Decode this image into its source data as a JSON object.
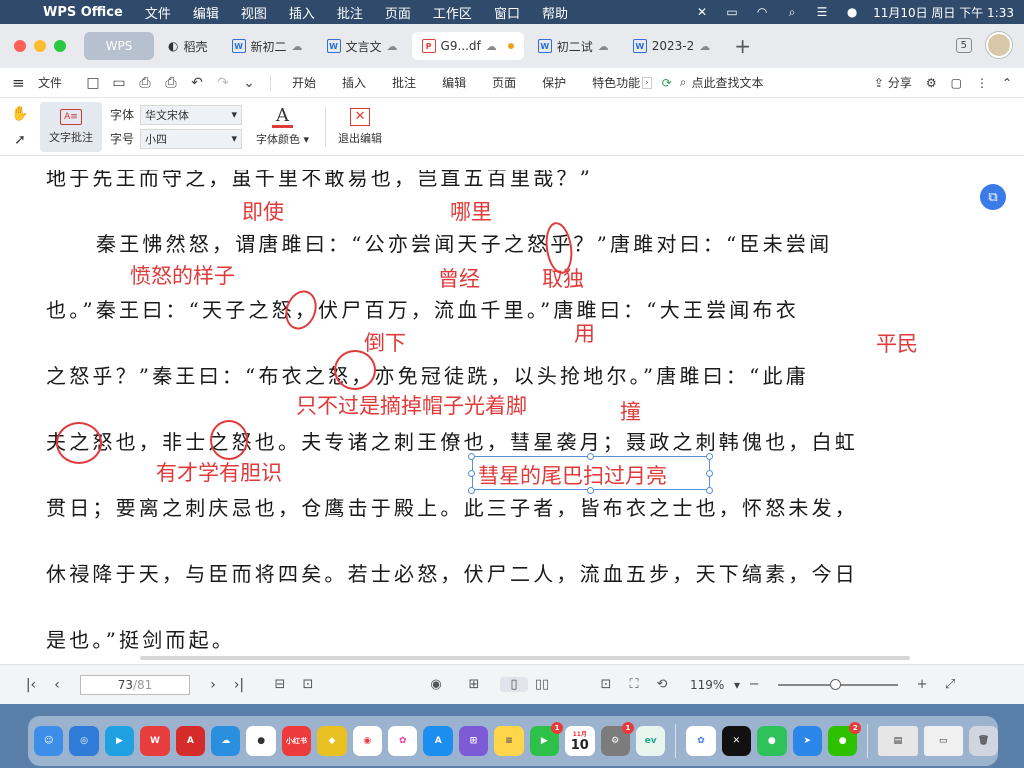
{
  "menubar": {
    "app_name": "WPS Office",
    "items": [
      "文件",
      "编辑",
      "视图",
      "插入",
      "批注",
      "页面",
      "工作区",
      "窗口",
      "帮助"
    ],
    "datetime": "11月10日 周日 下午 1:33"
  },
  "tabs": [
    {
      "label": "WPS"
    },
    {
      "label": "稻壳"
    },
    {
      "label": "新初二"
    },
    {
      "label": "文言文"
    },
    {
      "label": "G9...df"
    },
    {
      "label": "初二试"
    },
    {
      "label": "2023-2"
    }
  ],
  "toolbar": {
    "file_label": "文件",
    "ribbon_tabs": [
      "开始",
      "插入",
      "批注",
      "编辑",
      "页面",
      "保护",
      "特色功能"
    ],
    "search_label": "点此查找文本",
    "share_label": "分享",
    "page_count_badge": "5"
  },
  "ribbon": {
    "annotate_label": "文字批注",
    "font_label": "字体",
    "font_value": "华文宋体",
    "size_label": "字号",
    "size_value": "小四",
    "font_color_label": "字体颜色",
    "exit_label": "退出编辑"
  },
  "document": {
    "lines": [
      "地于先王而守之，虽千里不敢易也，岂直五百里哉？”",
      "秦王怫然怒，谓唐雎曰：“公亦尝闻天子之怒乎？”唐雎对曰：“臣未尝闻",
      "也。”秦王曰：“天子之怒，伏尸百万，流血千里。”唐雎曰：“大王尝闻布衣",
      "之怒乎？”秦王曰：“布衣之怒，亦免冠徒跣，以头抢地尔。”唐雎曰：“此庸",
      "夫之怒也，非士之怒也。夫专诸之刺王僚也，彗星袭月；聂政之刺韩傀也，白虹",
      "贯日；要离之刺庆忌也，仓鹰击于殿上。此三子者，皆布衣之士也，怀怒未发，",
      "休祲降于天，与臣而将四矣。若士必怒，伏尸二人，流血五步，天下缟素，今日",
      "是也。”挺剑而起。"
    ],
    "annotations": {
      "jishi": "即使",
      "nali": "哪里",
      "fennu": "愤怒的样子",
      "cengjing": "曾经",
      "qudu": "取独",
      "daoxia": "倒下",
      "yong": "用",
      "pingmin": "平民",
      "zhaimao": "只不过是摘掉帽子光着脚",
      "zhuang": "撞",
      "youcai": "有才学有胆识",
      "huixing": "彗星的尾巴扫过月亮"
    }
  },
  "status": {
    "page_current": "73",
    "page_total": "/81",
    "zoom": "119%"
  },
  "dock": {
    "calendar_day": "10",
    "calendar_month": "11月",
    "xhs_label": "小红书"
  }
}
